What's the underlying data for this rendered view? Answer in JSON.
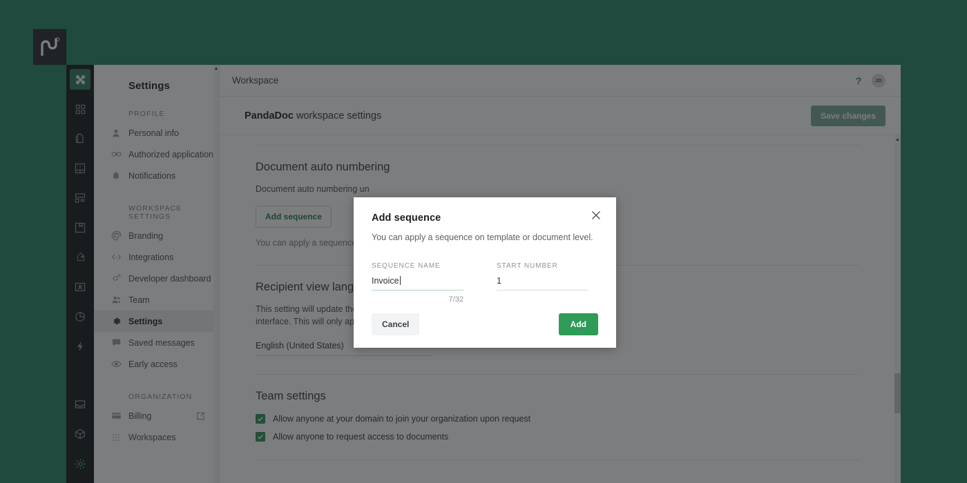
{
  "brand": {
    "logo_name": "pandadoc-logo",
    "green": "#288763",
    "accent": "#2e9b57"
  },
  "icon_rail": {
    "items": [
      {
        "name": "clover-icon",
        "active": true
      },
      {
        "name": "grid-dashboard-icon",
        "active": false
      },
      {
        "name": "documents-icon",
        "active": false
      },
      {
        "name": "templates-icon",
        "active": false
      },
      {
        "name": "content-library-icon",
        "active": false
      },
      {
        "name": "catalog-icon",
        "active": false
      },
      {
        "name": "pricing-tag-icon",
        "active": false
      },
      {
        "name": "contacts-icon",
        "active": false
      },
      {
        "name": "reports-pie-icon",
        "active": false
      },
      {
        "name": "automation-bolt-icon",
        "active": false
      }
    ],
    "bottom_items": [
      {
        "name": "inbox-icon",
        "accent": false
      },
      {
        "name": "integrations-cube-icon",
        "accent": false
      },
      {
        "name": "settings-gear-icon",
        "accent": true
      }
    ]
  },
  "nav": {
    "title": "Settings",
    "groups": [
      {
        "label": "PROFILE",
        "items": [
          {
            "label": "Personal info",
            "icon": "person-icon",
            "selected": false
          },
          {
            "label": "Authorized applications",
            "icon": "link-icon",
            "selected": false
          },
          {
            "label": "Notifications",
            "icon": "bell-icon",
            "selected": false
          }
        ]
      },
      {
        "label": "WORKSPACE SETTINGS",
        "items": [
          {
            "label": "Branding",
            "icon": "palette-icon",
            "selected": false
          },
          {
            "label": "Integrations",
            "icon": "code-brackets-icon",
            "selected": false
          },
          {
            "label": "Developer dashboard",
            "icon": "plug-icon",
            "selected": false
          },
          {
            "label": "Team",
            "icon": "people-icon",
            "selected": false
          },
          {
            "label": "Settings",
            "icon": "gear-icon",
            "selected": true
          },
          {
            "label": "Saved messages",
            "icon": "message-icon",
            "selected": false
          },
          {
            "label": "Early access",
            "icon": "eye-icon",
            "selected": false
          }
        ]
      },
      {
        "label": "ORGANIZATION",
        "items": [
          {
            "label": "Billing",
            "icon": "card-icon",
            "selected": false,
            "external": true
          },
          {
            "label": "Workspaces",
            "icon": "dots-grid-icon",
            "selected": false
          }
        ]
      }
    ]
  },
  "topbar": {
    "title": "Workspace",
    "help_icon": "question-mark-icon",
    "avatar_initials": "JD"
  },
  "subhead": {
    "title_bold": "PandaDoc",
    "title_rest": " workspace settings",
    "save_label": "Save changes"
  },
  "sections": {
    "auto_numbering": {
      "title": "Document auto numbering",
      "description": "Document auto numbering un",
      "button_label": "Add sequence",
      "footnote": "You can apply a sequence on t"
    },
    "recipient_language": {
      "title": "Recipient view language",
      "description_line1": "This setting will update the de",
      "description_line2": "interface. This will only apply t",
      "selected_language": "English (United States)"
    },
    "team_settings": {
      "title": "Team settings",
      "checkboxes": [
        {
          "label": "Allow anyone at your domain to join your organization upon request",
          "checked": true
        },
        {
          "label": "Allow anyone to request access to documents",
          "checked": true
        }
      ]
    }
  },
  "modal": {
    "title": "Add sequence",
    "description": "You can apply a sequence on template or document level.",
    "close_icon": "close-icon",
    "fields": [
      {
        "label": "SEQUENCE NAME",
        "value": "Invoice",
        "focused": true,
        "char_count": "7/32"
      },
      {
        "label": "START NUMBER",
        "value": "1",
        "focused": false,
        "char_count": ""
      }
    ],
    "cancel_label": "Cancel",
    "add_label": "Add"
  }
}
